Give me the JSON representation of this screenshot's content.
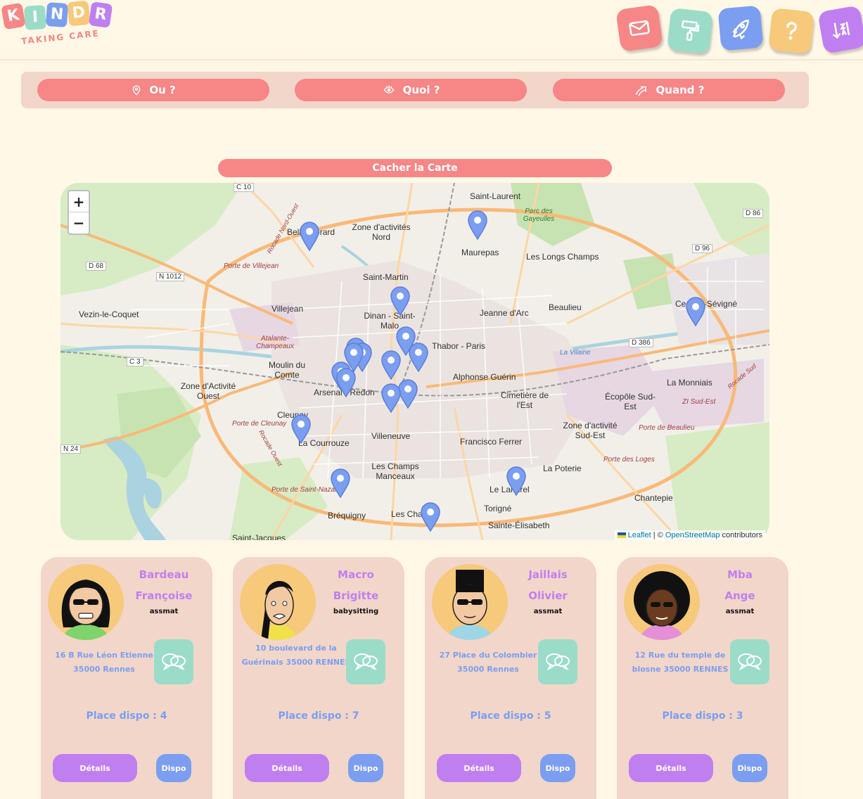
{
  "brand": {
    "letters": [
      "K",
      "I",
      "N",
      "D",
      "R"
    ],
    "tagline": "TAKING CARE"
  },
  "nav": [
    {
      "icon": "envelope-icon",
      "color": "#f78686"
    },
    {
      "icon": "paint-roller-icon",
      "color": "#9bdcc8"
    },
    {
      "icon": "rocket-icon",
      "color": "#7b9ef0"
    },
    {
      "icon": "question-icon",
      "color": "#f7c97a"
    },
    {
      "icon": "sort-icon",
      "color": "#c07ff0"
    }
  ],
  "filters": {
    "where": "Ou ?",
    "what": "Quoi ?",
    "when": "Quand ?"
  },
  "map": {
    "toggle_label": "Cacher la Carte",
    "zoom_in": "+",
    "zoom_out": "−",
    "attribution_leaflet": "Leaflet",
    "attribution_sep": " | © ",
    "attribution_osm": "OpenStreetMap",
    "attribution_tail": " contributors",
    "place_labels": [
      "Saint-Laurent",
      "Zone d'activités Nord",
      "Maurepas",
      "Les Longs Champs",
      "Saint-Martin",
      "Villejean",
      "Vezin-le-Coquet",
      "Jeanne d'Arc",
      "Beaulieu",
      "Cesson-Sévigné",
      "Dinan - Saint-Malo",
      "Thabor - Paris",
      "Moulin du Comte",
      "Zone d'Activité Ouest",
      "Arsenal - Redon",
      "Alphonse Guérin",
      "Cimetière de l'Est",
      "Écopôle Sud-Est",
      "La Monniais",
      "Cleunay",
      "La Courrouze",
      "Villeneuve",
      "Francisco Ferrer",
      "Zone d'activité Sud-Est",
      "Les Champs Manceaux",
      "La Poterie",
      "Le Landrel",
      "Torigné",
      "Chantepie",
      "Bréquigny",
      "Sainte-Élisabeth",
      "Les Champs",
      "Saint-Jacques",
      "Bellangerard"
    ],
    "road_labels": [
      "C 10",
      "D 86",
      "D 96",
      "D 68",
      "N 1012",
      "D 386",
      "C 3",
      "N 24",
      "Porte de Villejean",
      "Porte de Cleunay",
      "Porte de Saint-Nazaire",
      "Porte de Beaulieu",
      "Porte des Loges",
      "Rocade Nord-Ouest",
      "Rocade Ouest",
      "Rocade Sud",
      "Atalante-Champeaux",
      "ZI Sud-Est",
      "Parc des Gayeulles",
      "La Vilaine"
    ]
  },
  "nannies": [
    {
      "last_name": "Bardeau",
      "first_name": "Françoise",
      "role": "assmat",
      "address": "16 B Rue Léon Etienne 35000 Rennes",
      "places": "Place dispo : 4",
      "details": "Détails",
      "dispo": "Dispo"
    },
    {
      "last_name": "Macro",
      "first_name": "Brigitte",
      "role": "babysitting",
      "address": "10 boulevard de la Guérinais 35000 RENNES",
      "places": "Place dispo : 7",
      "details": "Détails",
      "dispo": "Dispo"
    },
    {
      "last_name": "Jaillais",
      "first_name": "Olivier",
      "role": "assmat",
      "address": "27 Place du Colombier 35000 Rennes",
      "places": "Place dispo : 5",
      "details": "Détails",
      "dispo": "Dispo"
    },
    {
      "last_name": "Mba",
      "first_name": "Ange",
      "role": "assmat",
      "address": "12 Rue du temple de blosne 35000 RENNES",
      "places": "Place dispo : 3",
      "details": "Détails",
      "dispo": "Dispo"
    }
  ],
  "colors": {
    "background": "#fff8e6",
    "coral": "#f78686",
    "mint": "#9bdcc8",
    "blue": "#7b9ef0",
    "yellow": "#f7c97a",
    "purple": "#c07ff0",
    "card": "#f2d6c9"
  }
}
